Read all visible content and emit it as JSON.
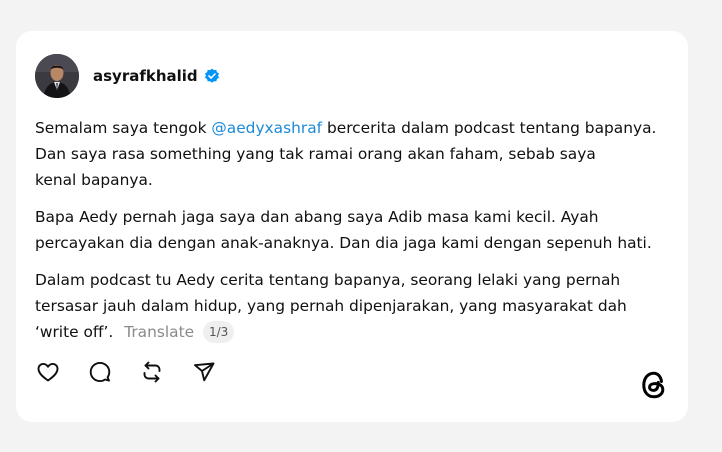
{
  "post": {
    "username": "asyrafkhalid",
    "paragraph1": {
      "before_mention": "Semalam saya tengok ",
      "mention": "@aedyxashraf",
      "after_mention_line1": " bercerita dalam podcast tentang bapanya.",
      "line2": "Dan saya rasa something yang tak ramai orang akan faham, sebab saya",
      "line3": "kenal bapanya."
    },
    "paragraph2": {
      "line1": "Bapa Aedy pernah jaga saya dan abang saya Adib masa kami kecil. Ayah",
      "line2": "percayakan dia dengan anak-anaknya. Dan dia jaga kami dengan sepenuh hati."
    },
    "paragraph3": {
      "line1": "Dalam podcast tu Aedy cerita tentang bapanya, seorang lelaki yang pernah",
      "line2": "tersasar jauh dalam hidup, yang pernah dipenjarakan, yang masyarakat dah",
      "line3": "‘write off’."
    },
    "translate_label": "Translate",
    "page_indicator": "1/3"
  },
  "colors": {
    "mention": "#1d8ad8",
    "verified": "#0095f6",
    "background": "#f3f3f3",
    "card": "#ffffff"
  },
  "icons": {
    "verified": "verified-badge-icon",
    "like": "heart-icon",
    "reply": "comment-bubble-icon",
    "repost": "repost-icon",
    "share": "send-icon",
    "brand": "threads-logo-icon"
  }
}
